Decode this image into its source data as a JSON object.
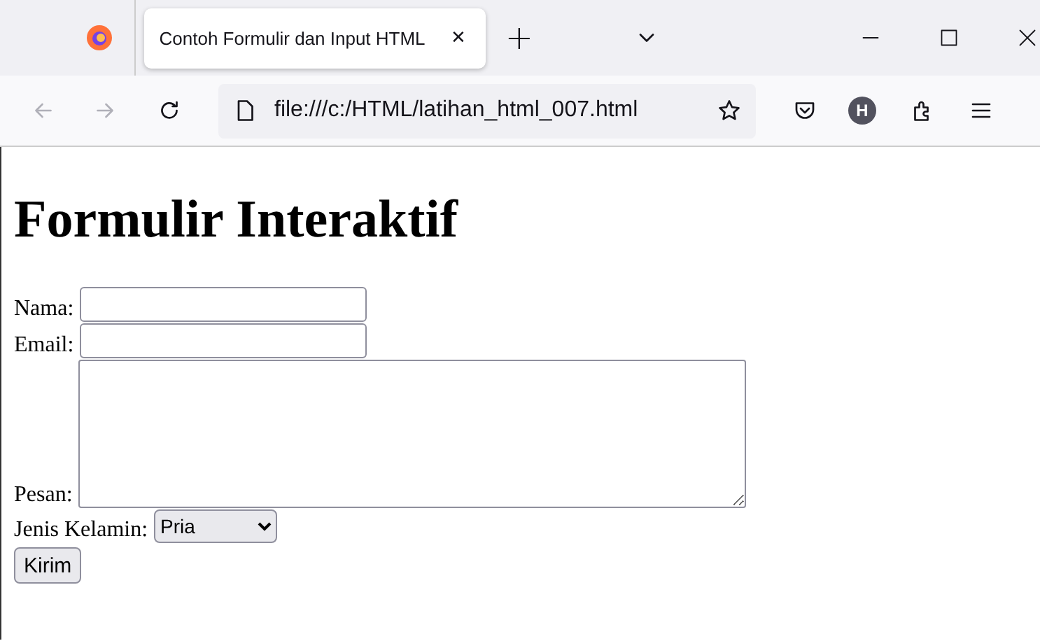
{
  "browser": {
    "tab_title": "Contoh Formulir dan Input HTML",
    "tab_close": "✕",
    "new_tab": "+",
    "address": "file:///c:/HTML/latihan_html_007.html",
    "profile_initial": "H"
  },
  "page": {
    "heading": "Formulir Interaktif",
    "fields": [
      {
        "kind": "text",
        "label": "Nama:"
      },
      {
        "kind": "text",
        "label": "Email:"
      },
      {
        "kind": "textarea",
        "label": "Pesan:"
      },
      {
        "kind": "select",
        "label": "Jenis Kelamin:",
        "value": "Pria"
      }
    ],
    "submit": "Kirim"
  }
}
